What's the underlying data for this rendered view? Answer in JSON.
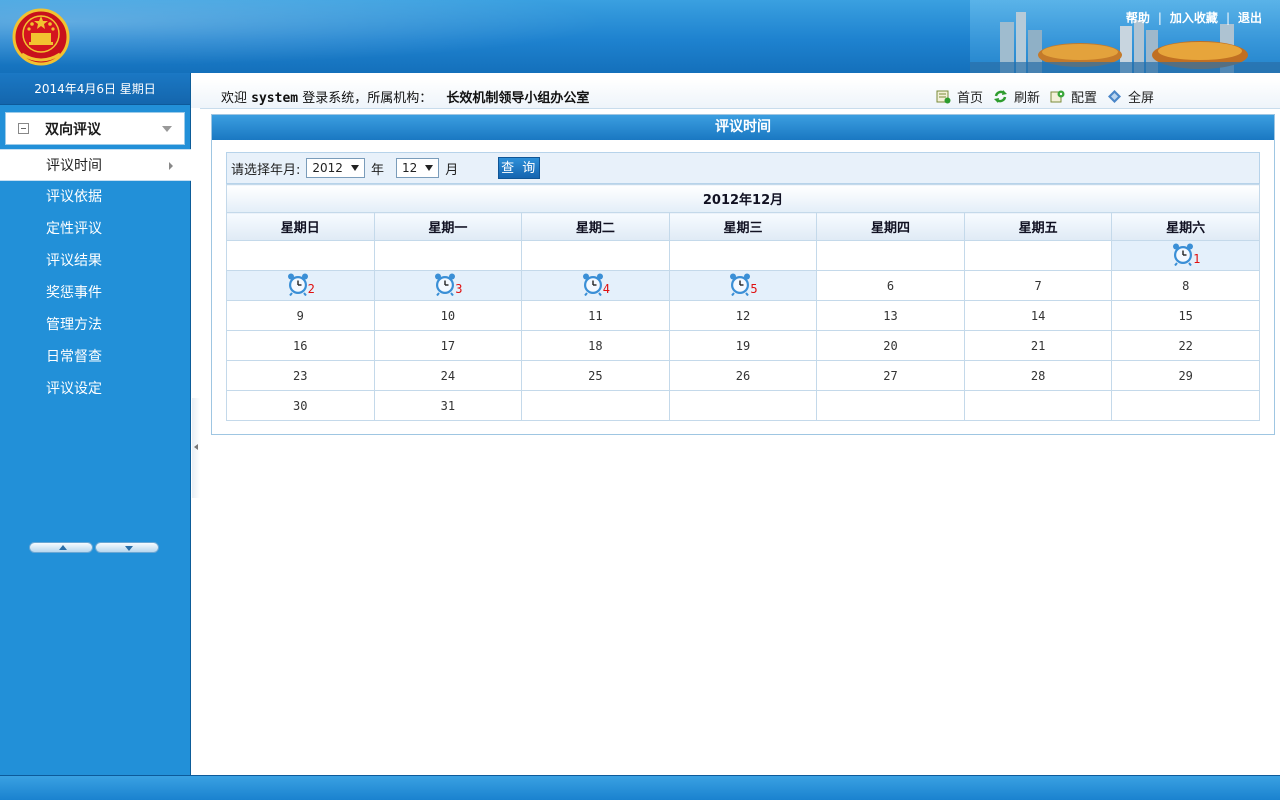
{
  "header": {
    "links": [
      "帮助",
      "加入收藏",
      "退出"
    ],
    "separator": "|"
  },
  "sidebar": {
    "date": "2014年4月6日  星期日",
    "section_title": "双向评议",
    "items": [
      "评议时间",
      "评议依据",
      "定性评议",
      "评议结果",
      "奖惩事件",
      "管理方法",
      "日常督查",
      "评议设定"
    ],
    "active_index": 0
  },
  "welcome": {
    "prefix": "欢迎",
    "user": "system",
    "middle": "登录系统，所属机构：",
    "org": "长效机制领导小组办公室"
  },
  "quick_links": [
    {
      "label": "首页",
      "icon": "home-icon"
    },
    {
      "label": "刷新",
      "icon": "refresh-icon"
    },
    {
      "label": "配置",
      "icon": "config-icon"
    },
    {
      "label": "全屏",
      "icon": "fullscreen-icon"
    }
  ],
  "panel": {
    "title": "评议时间",
    "query_label": "请选择年月:",
    "year_value": "2012",
    "year_unit": "年",
    "month_value": "12",
    "month_unit": "月",
    "query_button": "查 询"
  },
  "calendar": {
    "month_title": "2012年12月",
    "weekdays": [
      "星期日",
      "星期一",
      "星期二",
      "星期三",
      "星期四",
      "星期五",
      "星期六"
    ],
    "weeks": [
      [
        "",
        "",
        "",
        "",
        "",
        "",
        "1"
      ],
      [
        "2",
        "3",
        "4",
        "5",
        "6",
        "7",
        "8"
      ],
      [
        "9",
        "10",
        "11",
        "12",
        "13",
        "14",
        "15"
      ],
      [
        "16",
        "17",
        "18",
        "19",
        "20",
        "21",
        "22"
      ],
      [
        "23",
        "24",
        "25",
        "26",
        "27",
        "28",
        "29"
      ],
      [
        "30",
        "31",
        "",
        "",
        "",
        "",
        ""
      ]
    ],
    "event_days": [
      "1",
      "2",
      "3",
      "4",
      "5"
    ]
  },
  "colors": {
    "header_blue": "#1e82cf",
    "sidebar_blue": "#2290d8",
    "event_bg": "#e4f0fb",
    "event_number": "#e01010"
  }
}
